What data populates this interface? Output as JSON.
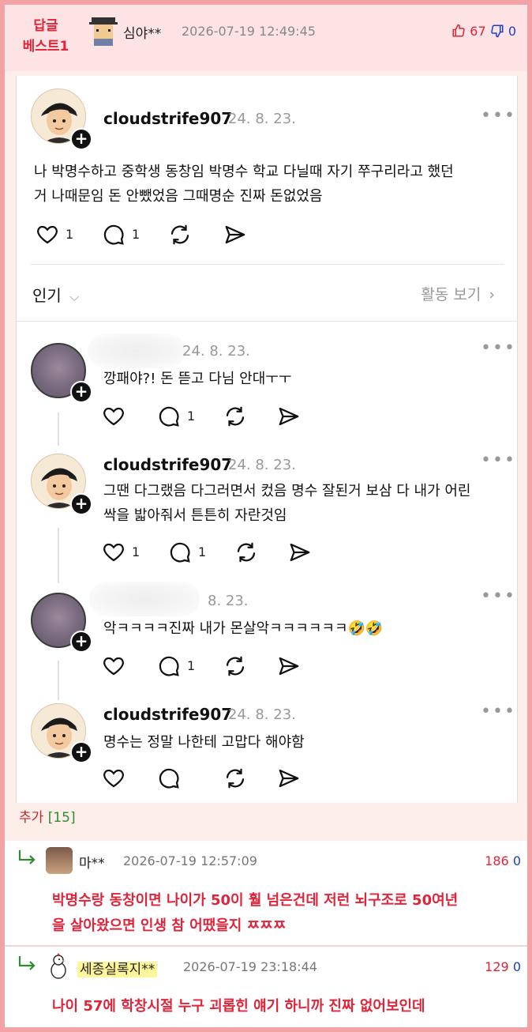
{
  "header": {
    "best_badge_line1": "답글",
    "best_badge_line2": "베스트1",
    "author": "심야**",
    "date": "2026-07-19 12:49:45",
    "upvotes": "67",
    "downvotes": "0"
  },
  "main_post": {
    "username": "cloudstrife907",
    "date": "24. 8. 23.",
    "text_line1": "나 박명수하고 중학생 동창임 박명수 학교 다닐때 자기 쭈구리라고 했던",
    "text_line2": "거 나때문임 돈 안뺐었음 그때명순 진짜 돈없었음",
    "likes": "1",
    "comments": "1"
  },
  "sort": {
    "label": "인기",
    "activity": "활동 보기"
  },
  "comments": [
    {
      "date": "24. 8. 23.",
      "text": "깡패야?! 돈 뜯고 다님 안대ㅜㅜ",
      "comments": "1"
    },
    {
      "username": "cloudstrife907",
      "date": "24. 8. 23.",
      "text_line1": "그땐 다그랬음 다그러면서 컸음 명수 잘된거 보삼 다 내가 어린",
      "text_line2": "싹을 밟아줘서 튼튼히 자란것임",
      "likes": "1",
      "comments": "1"
    },
    {
      "date": "8. 23.",
      "text": "악ㅋㅋㅋㅋ진짜 내가 몬살악ㅋㅋㅋㅋㅋㅋ🤣🤣",
      "comments": "1"
    },
    {
      "username": "cloudstrife907",
      "date": "24. 8. 23.",
      "text": "명수는 정말 나한테 고맙다 해야함"
    }
  ],
  "add_label": "추가",
  "add_count": "[15]",
  "replies": [
    {
      "author": "마**",
      "date": "2026-07-19 12:57:09",
      "upvotes": "186",
      "downvotes": "0",
      "text_line1": "박명수랑 동창이면 나이가 50이 훨 넘은건데 저런 뇌구조로 50여년",
      "text_line2": "을 살아왔으면 인생 참 어땠을지 ㅉㅉㅉ"
    },
    {
      "author": "세종실록지**",
      "date": "2026-07-19 23:18:44",
      "upvotes": "129",
      "downvotes": "0",
      "text_line1": "나이 57에 학창시절 누구 괴롭힌 얘기 하니까 진짜 없어보인데"
    }
  ],
  "colors": {
    "accent_red": "#e0243a",
    "down_blue": "#1a3fd6",
    "frame_pink": "#f3a3a6",
    "green": "#2e8b2e"
  }
}
